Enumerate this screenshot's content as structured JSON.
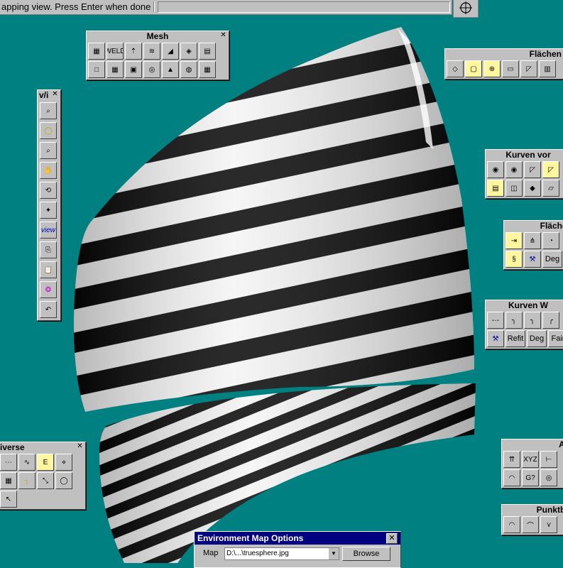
{
  "status": {
    "prompt": "apping view. Press Enter when done"
  },
  "palettes": {
    "mesh": {
      "title": "Mesh",
      "weld_label": "WELD"
    },
    "view": {
      "title": "v/i",
      "view_label": "view"
    },
    "flaechen1": {
      "title": "Flächen"
    },
    "kurven_vor": {
      "title": "Kurven vor"
    },
    "flaechen2": {
      "title": "Flächen",
      "deg_label": "Deg"
    },
    "kurven_w": {
      "title": "Kurven W",
      "refit_label": "Refit",
      "deg_label": "Deg",
      "fair_label": "Fair"
    },
    "inverse": {
      "title": "iverse"
    },
    "an": {
      "title": "An",
      "xyz_label": "XYZ",
      "g_label": "G?"
    },
    "punktbe": {
      "title": "Punktbe"
    }
  },
  "dialog": {
    "title": "Environment Map Options",
    "map_label": "Map",
    "map_value": "D:\\...\\truesphere.jpg",
    "browse_label": "Browse"
  },
  "colors": {
    "background": "#008080",
    "panel": "#c0c0c0",
    "titlebar": "#000080"
  }
}
